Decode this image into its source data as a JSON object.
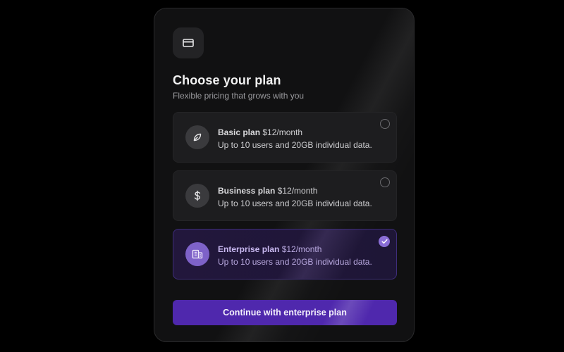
{
  "header": {
    "icon": "credit-card-icon",
    "title": "Choose your plan",
    "subtitle": "Flexible pricing that grows with you"
  },
  "plans": [
    {
      "id": "basic",
      "icon": "leaf-icon",
      "name": "Basic plan",
      "price": "$12/month",
      "description": "Up to 10 users and 20GB individual data.",
      "selected": false
    },
    {
      "id": "business",
      "icon": "dollar-icon",
      "name": "Business plan",
      "price": "$12/month",
      "description": "Up to 10 users and 20GB individual data.",
      "selected": false
    },
    {
      "id": "enterprise",
      "icon": "building-icon",
      "name": "Enterprise plan",
      "price": "$12/month",
      "description": "Up to 10 users and 20GB individual data.",
      "selected": true
    }
  ],
  "continue_button": {
    "label": "Continue with enterprise plan"
  },
  "colors": {
    "accent": "#4f28ad",
    "selected_border": "#3e2d7a",
    "check": "#8a6ed6"
  }
}
